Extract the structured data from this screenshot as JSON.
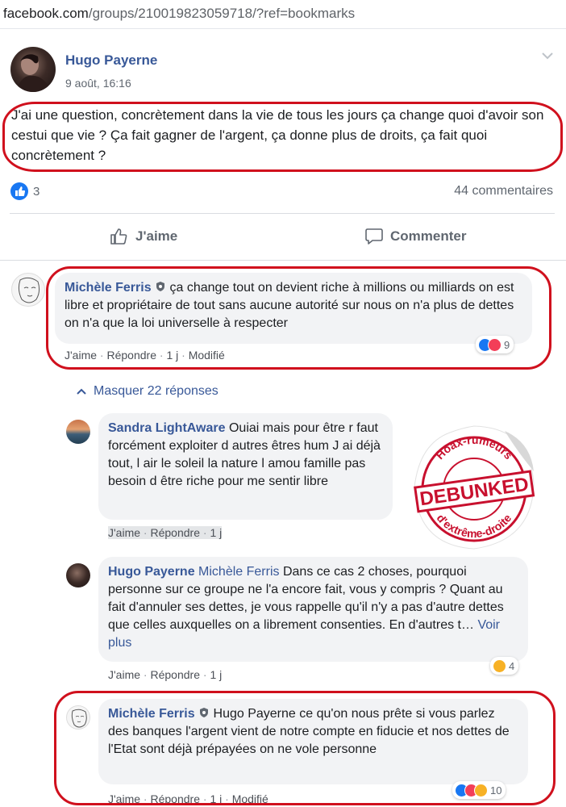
{
  "browser": {
    "url_domain": "facebook.com",
    "url_path": "/groups/210019823059718/?ref=bookmarks"
  },
  "post": {
    "author": "Hugo Payerne",
    "date": "9 août, 16:16",
    "text": "J'ai une question, concrètement dans la vie de tous les jours ça change quoi d'avoir son cestui que vie ? Ça fait gagner de l'argent, ça donne plus de droits, ça fait quoi concrètement ?",
    "likes": "3",
    "comments": "44 commentaires",
    "like_label": "J'aime",
    "comment_label": "Commenter"
  },
  "comments": [
    {
      "author": "Michèle Ferris",
      "text": "ça change tout on devient riche à millions ou milliards on est libre et propriétaire de tout sans aucune autorité sur nous on n'a plus de dettes on n'a que la loi universelle à respecter",
      "like": "J'aime",
      "reply": "Répondre",
      "time": "1 j",
      "edited": "Modifié",
      "reactions": "9"
    },
    {
      "hide_replies": "Masquer 22 réponses"
    },
    {
      "author": "Sandra LightAware",
      "text": "Ouiai mais pour être r faut forcément exploiter d autres êtres hum J ai déjà tout, l air le soleil la nature l amou famille pas besoin d être riche pour me sentir libre",
      "like": "J'aime",
      "reply": "Répondre",
      "time": "1 j"
    },
    {
      "author": "Hugo Payerne",
      "mention": "Michèle Ferris",
      "text": "Dans ce cas 2 choses, pourquoi personne sur ce groupe ne l'a encore fait, vous y compris ? Quant au fait d'annuler ses dettes, je vous rappelle qu'il n'y a pas d'autre dettes que celles auxquelles on a librement consenties. En d'autres t…",
      "more": "Voir plus",
      "like": "J'aime",
      "reply": "Répondre",
      "time": "1 j",
      "reactions": "4"
    },
    {
      "author": "Michèle Ferris",
      "text": "Hugo Payerne ce qu'on nous prête si vous parlez des banques l'argent vient de notre compte en fiducie et nos dettes de l'Etat sont déjà prépayées on ne vole personne",
      "like": "J'aime",
      "reply": "Répondre",
      "time": "1 j",
      "edited": "Modifié",
      "reactions": "10"
    }
  ],
  "stamp": {
    "top": "Hoax-rumeurs",
    "middle": "DEBUNKED",
    "bottom": "d'extrême-droite"
  },
  "colors": {
    "brand": "#385898",
    "highlight": "#d0101d",
    "stamp": "#c8102e"
  }
}
